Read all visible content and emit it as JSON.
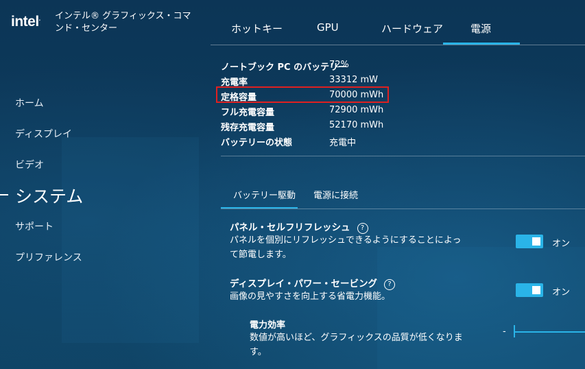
{
  "app": {
    "logo": "intel",
    "title": "インテル® グラフィックス・コマンド・センター"
  },
  "sidebar": {
    "items": [
      {
        "label": "ホーム"
      },
      {
        "label": "ディスプレイ"
      },
      {
        "label": "ビデオ"
      },
      {
        "label": "システム",
        "active": true
      },
      {
        "label": "サポート"
      },
      {
        "label": "プリファレンス"
      }
    ]
  },
  "tabs": [
    {
      "label": "ホットキー"
    },
    {
      "label": "GPU"
    },
    {
      "label": "ハードウェア"
    },
    {
      "label": "電源",
      "active": true
    }
  ],
  "battery_info": [
    {
      "label": "ノートブック PC のバッテリー",
      "value": "72%"
    },
    {
      "label": "充電率",
      "value": "33312 mW"
    },
    {
      "label": "定格容量",
      "value": "70000 mWh",
      "highlighted": true
    },
    {
      "label": "フル充電容量",
      "value": "72900 mWh"
    },
    {
      "label": "残存充電容量",
      "value": "52170 mWh"
    },
    {
      "label": "バッテリーの状態",
      "value": "充電中"
    }
  ],
  "sub_tabs": [
    {
      "label": "バッテリー駆動",
      "active": true
    },
    {
      "label": "電源に接続"
    }
  ],
  "settings": {
    "panel_self_refresh": {
      "title": "パネル・セルフリフレッシュ",
      "help": "?",
      "desc_line1": "パネルを個別にリフレッシュできるようにすることによっ",
      "desc_line2": "て節電します。",
      "toggle_state": "オン"
    },
    "display_power_saving": {
      "title": "ディスプレイ・パワー・セービング",
      "help": "?",
      "desc": "画像の見やすさを向上する省電力機能。",
      "toggle_state": "オン"
    },
    "power_efficiency": {
      "title": "電力効率",
      "desc_line1": "数値が高いほど、グラフィックスの品質が低くなりま",
      "desc_line2": "す。",
      "slider_minus": "-"
    }
  },
  "colors": {
    "accent": "#2ab4e8",
    "highlight_box": "#e02020",
    "background": "#0d3a5a"
  }
}
